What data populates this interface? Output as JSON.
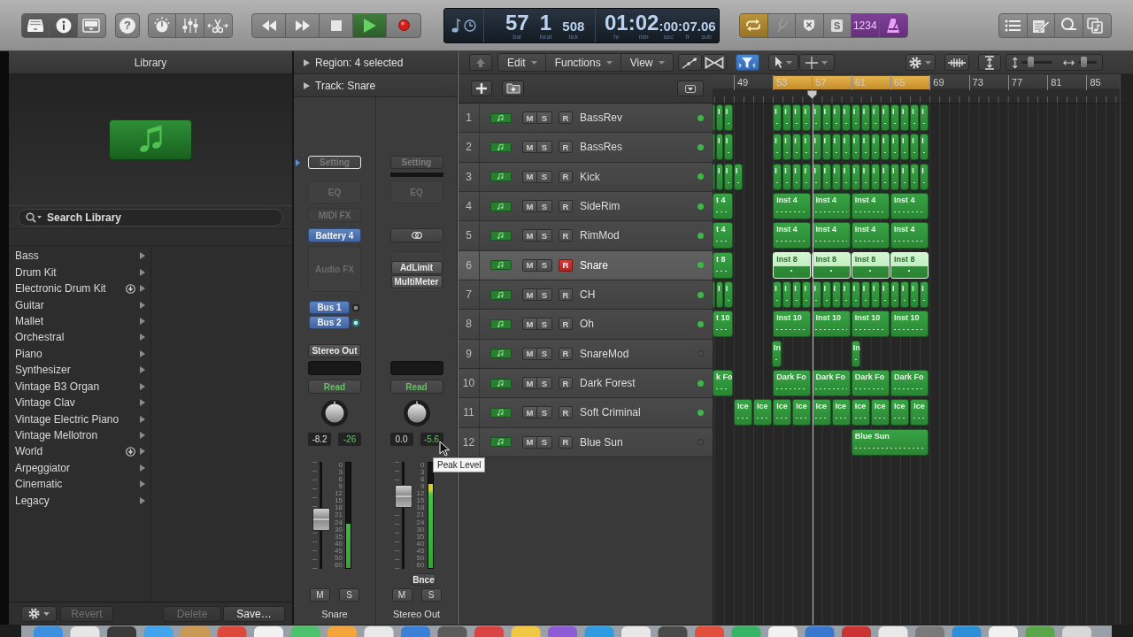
{
  "toolbar": {
    "view_buttons": [
      {
        "kind": "library",
        "selected": true
      },
      {
        "kind": "inspector",
        "selected": true
      },
      {
        "kind": "editors",
        "selected": false
      }
    ],
    "help": {
      "label": "?"
    },
    "transport": [
      {
        "kind": "rewind",
        "on": false
      },
      {
        "kind": "forward",
        "on": false
      },
      {
        "kind": "stop",
        "on": false
      },
      {
        "kind": "play",
        "on": true
      },
      {
        "kind": "record",
        "on": false
      }
    ],
    "lcd": {
      "position": [
        {
          "value": "57",
          "unit": "bar"
        },
        {
          "value": "1",
          "unit": "beat"
        },
        {
          "value": "508",
          "unit": "tick"
        }
      ],
      "time": [
        {
          "value": "01",
          "unit": "hr"
        },
        {
          "value": ":02",
          "unit": "min"
        },
        {
          "value": ":00",
          "unit": "sec"
        },
        {
          "value": ":07",
          "unit": "fr"
        },
        {
          "value": ".06",
          "unit": "sub"
        }
      ]
    },
    "modes": [
      {
        "kind": "cycle",
        "on": true,
        "disabled": false
      },
      {
        "kind": "tuner",
        "on": false,
        "disabled": true
      },
      {
        "kind": "replace",
        "on": false,
        "disabled": false
      },
      {
        "kind": "solo",
        "label": "S",
        "on": false,
        "disabled": false
      },
      {
        "kind": "count_in",
        "label": "1234",
        "on": true,
        "disabled": false
      },
      {
        "kind": "metronome",
        "on": true,
        "disabled": false
      }
    ]
  },
  "library": {
    "title": "Library",
    "search": {
      "placeholder": "Search Library"
    },
    "categories": [
      {
        "label": "Bass",
        "download": false
      },
      {
        "label": "Drum Kit",
        "download": false
      },
      {
        "label": "Electronic Drum Kit",
        "download": true
      },
      {
        "label": "Guitar",
        "download": false
      },
      {
        "label": "Mallet",
        "download": false
      },
      {
        "label": "Orchestral",
        "download": false
      },
      {
        "label": "Piano",
        "download": false
      },
      {
        "label": "Synthesizer",
        "download": false
      },
      {
        "label": "Vintage B3 Organ",
        "download": false
      },
      {
        "label": "Vintage Clav",
        "download": false
      },
      {
        "label": "Vintage Electric Piano",
        "download": false
      },
      {
        "label": "Vintage Mellotron",
        "download": false
      },
      {
        "label": "World",
        "download": true
      },
      {
        "label": "Arpeggiator",
        "download": false
      },
      {
        "label": "Cinematic",
        "download": false
      },
      {
        "label": "Legacy",
        "download": false
      }
    ],
    "footer": [
      {
        "label": "Revert",
        "disabled": true
      },
      {
        "label": "Delete",
        "disabled": true
      },
      {
        "label": "Save…",
        "disabled": false
      }
    ]
  },
  "inspector": {
    "sections": [
      {
        "label": "Region: 4 selected",
        "expanded": false
      },
      {
        "label": "Track: Snare",
        "expanded": false
      }
    ],
    "strips": [
      {
        "kind": "instrument",
        "setting": "Setting",
        "focused": true,
        "eq": "EQ",
        "midi_fx": "MIDI FX",
        "instrument": "Battery 4",
        "audio_fx_placeholder": "Audio FX",
        "sends": [
          {
            "label": "Bus 1",
            "on": false
          },
          {
            "label": "Bus 2",
            "on": true
          }
        ],
        "output": "Stereo Out",
        "automation": "Read",
        "volume": "-8.2",
        "peak": "-26",
        "fader": {
          "level": 0.45
        },
        "meter": {
          "level": 0.42
        },
        "scale": [
          "0",
          "3",
          "6",
          "9",
          "12",
          "15",
          "18",
          "21",
          "24",
          "30",
          "35",
          "40",
          "45",
          "50",
          "60"
        ],
        "buttons": [
          {
            "label": "M",
            "on": false
          },
          {
            "label": "S",
            "on": false
          }
        ],
        "name": "Snare"
      },
      {
        "kind": "output",
        "setting": "Setting",
        "focused": false,
        "eq": "EQ",
        "audio_fx": [
          "AdLimit",
          "MultiMeter"
        ],
        "automation": "Read",
        "volume": "0.0",
        "peak": "-5.6",
        "fader": {
          "level": 0.73
        },
        "meter": {
          "level": 0.8
        },
        "scale": [
          "0",
          "3",
          "6",
          "9",
          "12",
          "15",
          "18",
          "21",
          "24",
          "30",
          "35",
          "40",
          "45",
          "50",
          "60"
        ],
        "bounce": "Bnce",
        "buttons": [
          {
            "label": "M",
            "on": false
          },
          {
            "label": "S",
            "on": false
          }
        ],
        "name": "Stereo Out"
      }
    ]
  },
  "tooltip": {
    "text": "Peak Level"
  },
  "tracks": {
    "menus": [
      {
        "label": "Edit"
      },
      {
        "label": "Functions"
      },
      {
        "label": "View"
      }
    ],
    "toggles": [
      {
        "kind": "automation",
        "on": false
      },
      {
        "kind": "flex",
        "on": false
      },
      {
        "kind": "filter",
        "on": true
      }
    ],
    "zoom": [
      {
        "kind": "vertical",
        "level": 0.25
      },
      {
        "kind": "horizontal",
        "level": 0.2
      }
    ],
    "ruler": {
      "bars": [
        "49",
        "53",
        "57",
        "61",
        "65",
        "69",
        "73",
        "77",
        "81",
        "85"
      ]
    },
    "rows": [
      {
        "number": "1",
        "name": "BassRev",
        "selected": false,
        "active": true,
        "buttons": [
          {
            "kind": "mute",
            "label": "M",
            "on": false
          },
          {
            "kind": "solo",
            "label": "S",
            "on": false
          },
          {
            "kind": "record",
            "label": "R",
            "on": false
          }
        ],
        "regions": [
          {
            "selected": false
          },
          {
            "label": "I",
            "selected": false
          },
          {
            "label": "I",
            "selected": false
          },
          {
            "label": "I",
            "selected": false
          },
          {
            "label": "I",
            "selected": false
          },
          {
            "label": "I",
            "selected": false
          },
          {
            "label": "I",
            "selected": false
          },
          {
            "label": "I",
            "selected": false
          },
          {
            "label": "I",
            "selected": false
          },
          {
            "label": "I",
            "selected": false
          },
          {
            "label": "I",
            "selected": false
          },
          {
            "label": "I",
            "selected": false
          },
          {
            "label": "I",
            "selected": false
          },
          {
            "label": "I",
            "selected": false
          },
          {
            "label": "I",
            "selected": false
          },
          {
            "label": "I",
            "selected": false
          },
          {
            "label": "I",
            "selected": false
          },
          {
            "label": "I",
            "selected": false
          },
          {
            "label": "I",
            "selected": false
          }
        ]
      },
      {
        "number": "2",
        "name": "BassRes",
        "selected": false,
        "active": true,
        "buttons": [
          {
            "kind": "mute",
            "label": "M",
            "on": false
          },
          {
            "kind": "solo",
            "label": "S",
            "on": false
          },
          {
            "kind": "record",
            "label": "R",
            "on": false
          }
        ],
        "regions": [
          {
            "selected": false
          },
          {
            "label": "I",
            "selected": false
          },
          {
            "label": "I",
            "selected": false
          },
          {
            "label": "I",
            "selected": false
          },
          {
            "label": "I",
            "selected": false
          },
          {
            "label": "I",
            "selected": false
          },
          {
            "label": "I",
            "selected": false
          },
          {
            "label": "I",
            "selected": false
          },
          {
            "label": "I",
            "selected": false
          },
          {
            "label": "I",
            "selected": false
          },
          {
            "label": "I",
            "selected": false
          },
          {
            "label": "I",
            "selected": false
          },
          {
            "label": "I",
            "selected": false
          },
          {
            "label": "I",
            "selected": false
          },
          {
            "label": "I",
            "selected": false
          },
          {
            "label": "I",
            "selected": false
          },
          {
            "label": "I",
            "selected": false
          },
          {
            "label": "I",
            "selected": false
          },
          {
            "label": "I",
            "selected": false
          }
        ]
      },
      {
        "number": "3",
        "name": "Kick",
        "selected": false,
        "active": true,
        "buttons": [
          {
            "kind": "mute",
            "label": "M",
            "on": false
          },
          {
            "kind": "solo",
            "label": "S",
            "on": false
          },
          {
            "kind": "record",
            "label": "R",
            "on": false
          }
        ],
        "regions": [
          {
            "selected": false
          },
          {
            "label": "I",
            "selected": false
          },
          {
            "label": "I",
            "selected": false
          },
          {
            "label": "I",
            "selected": false
          },
          {
            "label": "I",
            "selected": false
          },
          {
            "label": "I",
            "selected": false
          },
          {
            "label": "I",
            "selected": false
          },
          {
            "label": "I",
            "selected": false
          },
          {
            "label": "I",
            "selected": false
          },
          {
            "label": "I",
            "selected": false
          },
          {
            "label": "I",
            "selected": false
          },
          {
            "label": "I",
            "selected": false
          },
          {
            "label": "I",
            "selected": false
          },
          {
            "label": "I",
            "selected": false
          },
          {
            "label": "I",
            "selected": false
          },
          {
            "label": "I",
            "selected": false
          },
          {
            "label": "I",
            "selected": false
          },
          {
            "label": "I",
            "selected": false
          },
          {
            "label": "I",
            "selected": false
          },
          {
            "label": "I",
            "selected": false
          }
        ]
      },
      {
        "number": "4",
        "name": "SideRim",
        "selected": false,
        "active": true,
        "buttons": [
          {
            "kind": "mute",
            "label": "M",
            "on": false
          },
          {
            "kind": "solo",
            "label": "S",
            "on": false
          },
          {
            "kind": "record",
            "label": "R",
            "on": false
          }
        ],
        "regions": [
          {
            "label": "t 4",
            "selected": false
          },
          {
            "label": "Inst 4",
            "selected": false
          },
          {
            "label": "Inst 4",
            "selected": false
          },
          {
            "label": "Inst 4",
            "selected": false
          },
          {
            "label": "Inst 4",
            "selected": false
          }
        ]
      },
      {
        "number": "5",
        "name": "RimMod",
        "selected": false,
        "active": true,
        "buttons": [
          {
            "kind": "mute",
            "label": "M",
            "on": false
          },
          {
            "kind": "solo",
            "label": "S",
            "on": false
          },
          {
            "kind": "record",
            "label": "R",
            "on": false
          }
        ],
        "regions": [
          {
            "label": "t 4",
            "selected": false
          },
          {
            "label": "Inst 4",
            "selected": false
          },
          {
            "label": "Inst 4",
            "selected": false
          },
          {
            "label": "Inst 4",
            "selected": false
          },
          {
            "label": "Inst 4",
            "selected": false
          }
        ]
      },
      {
        "number": "6",
        "name": "Snare",
        "selected": true,
        "active": true,
        "buttons": [
          {
            "kind": "mute",
            "label": "M",
            "on": false
          },
          {
            "kind": "solo",
            "label": "S",
            "on": false
          },
          {
            "kind": "record",
            "label": "R",
            "on": true
          }
        ],
        "regions": [
          {
            "label": "t 8",
            "selected": false
          },
          {
            "label": "Inst 8",
            "selected": true
          },
          {
            "label": "Inst 8",
            "selected": true
          },
          {
            "label": "Inst 8",
            "selected": true
          },
          {
            "label": "Inst 8",
            "selected": true
          }
        ]
      },
      {
        "number": "7",
        "name": "CH",
        "selected": false,
        "active": true,
        "buttons": [
          {
            "kind": "mute",
            "label": "M",
            "on": false
          },
          {
            "kind": "solo",
            "label": "S",
            "on": false
          },
          {
            "kind": "record",
            "label": "R",
            "on": false
          }
        ],
        "regions": [
          {
            "selected": false
          },
          {
            "label": "I",
            "selected": false
          },
          {
            "label": "I",
            "selected": false
          },
          {
            "label": "I",
            "selected": false
          },
          {
            "label": "I",
            "selected": false
          },
          {
            "label": "I",
            "selected": false
          },
          {
            "label": "I",
            "selected": false
          },
          {
            "label": "I",
            "selected": false
          },
          {
            "label": "I",
            "selected": false
          },
          {
            "label": "I",
            "selected": false
          },
          {
            "label": "I",
            "selected": false
          },
          {
            "label": "I",
            "selected": false
          },
          {
            "label": "I",
            "selected": false
          },
          {
            "label": "I",
            "selected": false
          },
          {
            "label": "I",
            "selected": false
          },
          {
            "label": "I",
            "selected": false
          },
          {
            "label": "I",
            "selected": false
          },
          {
            "label": "I",
            "selected": false
          },
          {
            "label": "I",
            "selected": false
          }
        ]
      },
      {
        "number": "8",
        "name": "Oh",
        "selected": false,
        "active": true,
        "buttons": [
          {
            "kind": "mute",
            "label": "M",
            "on": false
          },
          {
            "kind": "solo",
            "label": "S",
            "on": false
          },
          {
            "kind": "record",
            "label": "R",
            "on": false
          }
        ],
        "regions": [
          {
            "label": "t 10",
            "selected": false
          },
          {
            "label": "Inst 10",
            "selected": false
          },
          {
            "label": "Inst 10",
            "selected": false
          },
          {
            "label": "Inst 10",
            "selected": false
          },
          {
            "label": "Inst 10",
            "selected": false
          }
        ]
      },
      {
        "number": "9",
        "name": "SnareMod",
        "selected": false,
        "active": false,
        "buttons": [
          {
            "kind": "mute",
            "label": "M",
            "on": false
          },
          {
            "kind": "solo",
            "label": "S",
            "on": false
          },
          {
            "kind": "record",
            "label": "R",
            "on": false
          }
        ],
        "regions": [
          {
            "label": "In",
            "selected": false
          },
          {
            "label": "In",
            "selected": false
          }
        ]
      },
      {
        "number": "10",
        "name": "Dark Forest",
        "selected": false,
        "active": true,
        "buttons": [
          {
            "kind": "mute",
            "label": "M",
            "on": false
          },
          {
            "kind": "solo",
            "label": "S",
            "on": false
          },
          {
            "kind": "record",
            "label": "R",
            "on": false
          }
        ],
        "regions": [
          {
            "label": "k Fo",
            "selected": false
          },
          {
            "label": "Dark Fo",
            "selected": false
          },
          {
            "label": "Dark Fo",
            "selected": false
          },
          {
            "label": "Dark Fo",
            "selected": false
          },
          {
            "label": "Dark Fo",
            "selected": false
          }
        ]
      },
      {
        "number": "11",
        "name": "Soft Criminal",
        "selected": false,
        "active": true,
        "buttons": [
          {
            "kind": "mute",
            "label": "M",
            "on": false
          },
          {
            "kind": "solo",
            "label": "S",
            "on": false
          },
          {
            "kind": "record",
            "label": "R",
            "on": false
          }
        ],
        "regions": [
          {
            "label": "Ice",
            "selected": false
          },
          {
            "label": "Ice",
            "selected": false
          },
          {
            "label": "Ice",
            "selected": false
          },
          {
            "label": "Ice",
            "selected": false
          },
          {
            "label": "Ice",
            "selected": false
          },
          {
            "label": "Ice",
            "selected": false
          },
          {
            "label": "Ice",
            "selected": false
          },
          {
            "label": "Ice",
            "selected": false
          },
          {
            "label": "Ice",
            "selected": false
          },
          {
            "label": "Ice",
            "selected": false
          }
        ]
      },
      {
        "number": "12",
        "name": "Blue Sun",
        "selected": false,
        "active": false,
        "buttons": [
          {
            "kind": "mute",
            "label": "M",
            "on": false
          },
          {
            "kind": "solo",
            "label": "S",
            "on": false
          },
          {
            "kind": "record",
            "label": "R",
            "on": false
          }
        ],
        "regions": [
          {
            "label": "Blue Sun",
            "selected": false
          }
        ]
      }
    ]
  }
}
